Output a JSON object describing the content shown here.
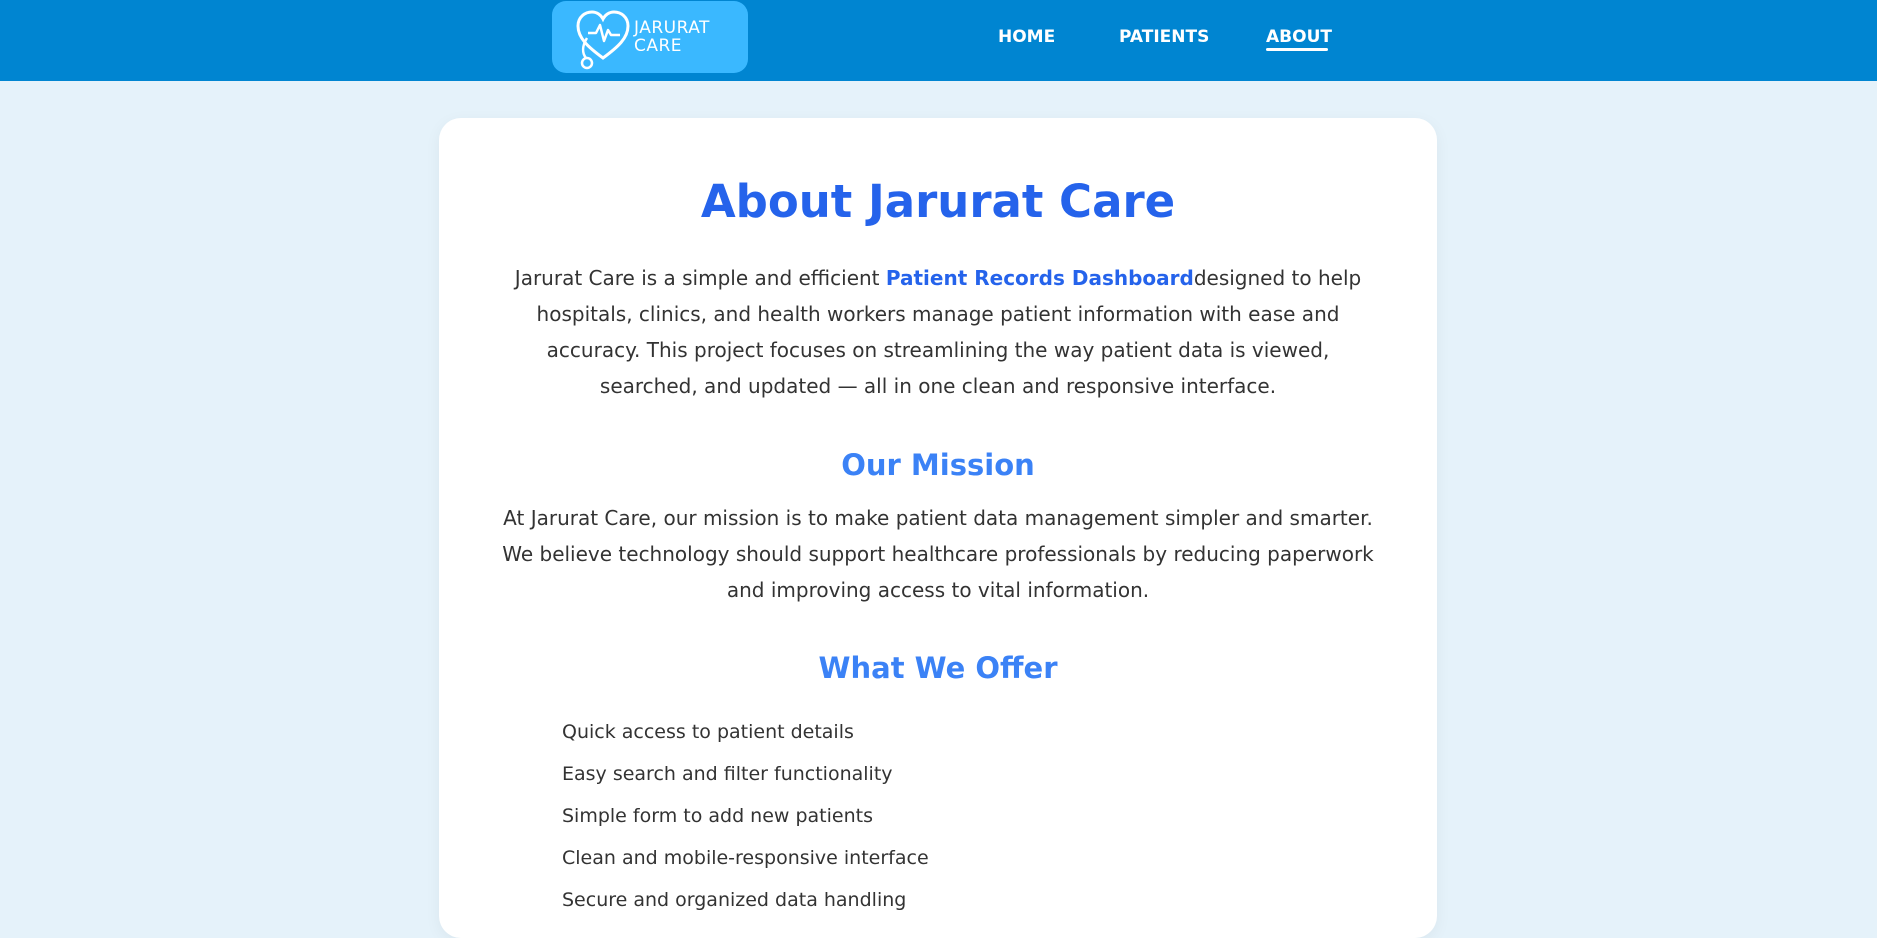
{
  "brand": {
    "logo_line1": "JARURAT",
    "logo_line2": "CARE",
    "logo_icon": "heart-stethoscope-icon"
  },
  "nav": {
    "items": [
      {
        "label": "HOME",
        "active": false
      },
      {
        "label": "PATIENTS",
        "active": false
      },
      {
        "label": "ABOUT",
        "active": true
      }
    ]
  },
  "main": {
    "title": "About Jarurat Care",
    "intro_before": "Jarurat Care is a simple and efficient ",
    "intro_highlight": "Patient Records Dashboard",
    "intro_after": "designed to help hospitals, clinics, and health workers manage patient information with ease and accuracy. This project focuses on streamlining the way patient data is viewed, searched, and updated — all in one clean and responsive interface.",
    "mission_heading": "Our Mission",
    "mission_text": "At Jarurat Care, our mission is to make patient data management simpler and smarter. We believe technology should support healthcare professionals by reducing paperwork and improving access to vital information.",
    "offer_heading": "What We Offer",
    "offer_items": [
      "Quick access to patient details",
      "Easy search and filter functionality",
      "Simple form to add new patients",
      "Clean and mobile-responsive interface",
      "Secure and organized data handling"
    ]
  },
  "colors": {
    "navbar": "#0085d1",
    "logo_bg": "#3ab8ff",
    "page_bg": "#e5f2fa",
    "title": "#2563eb",
    "heading": "#3b82f6",
    "body_text": "#333333"
  }
}
